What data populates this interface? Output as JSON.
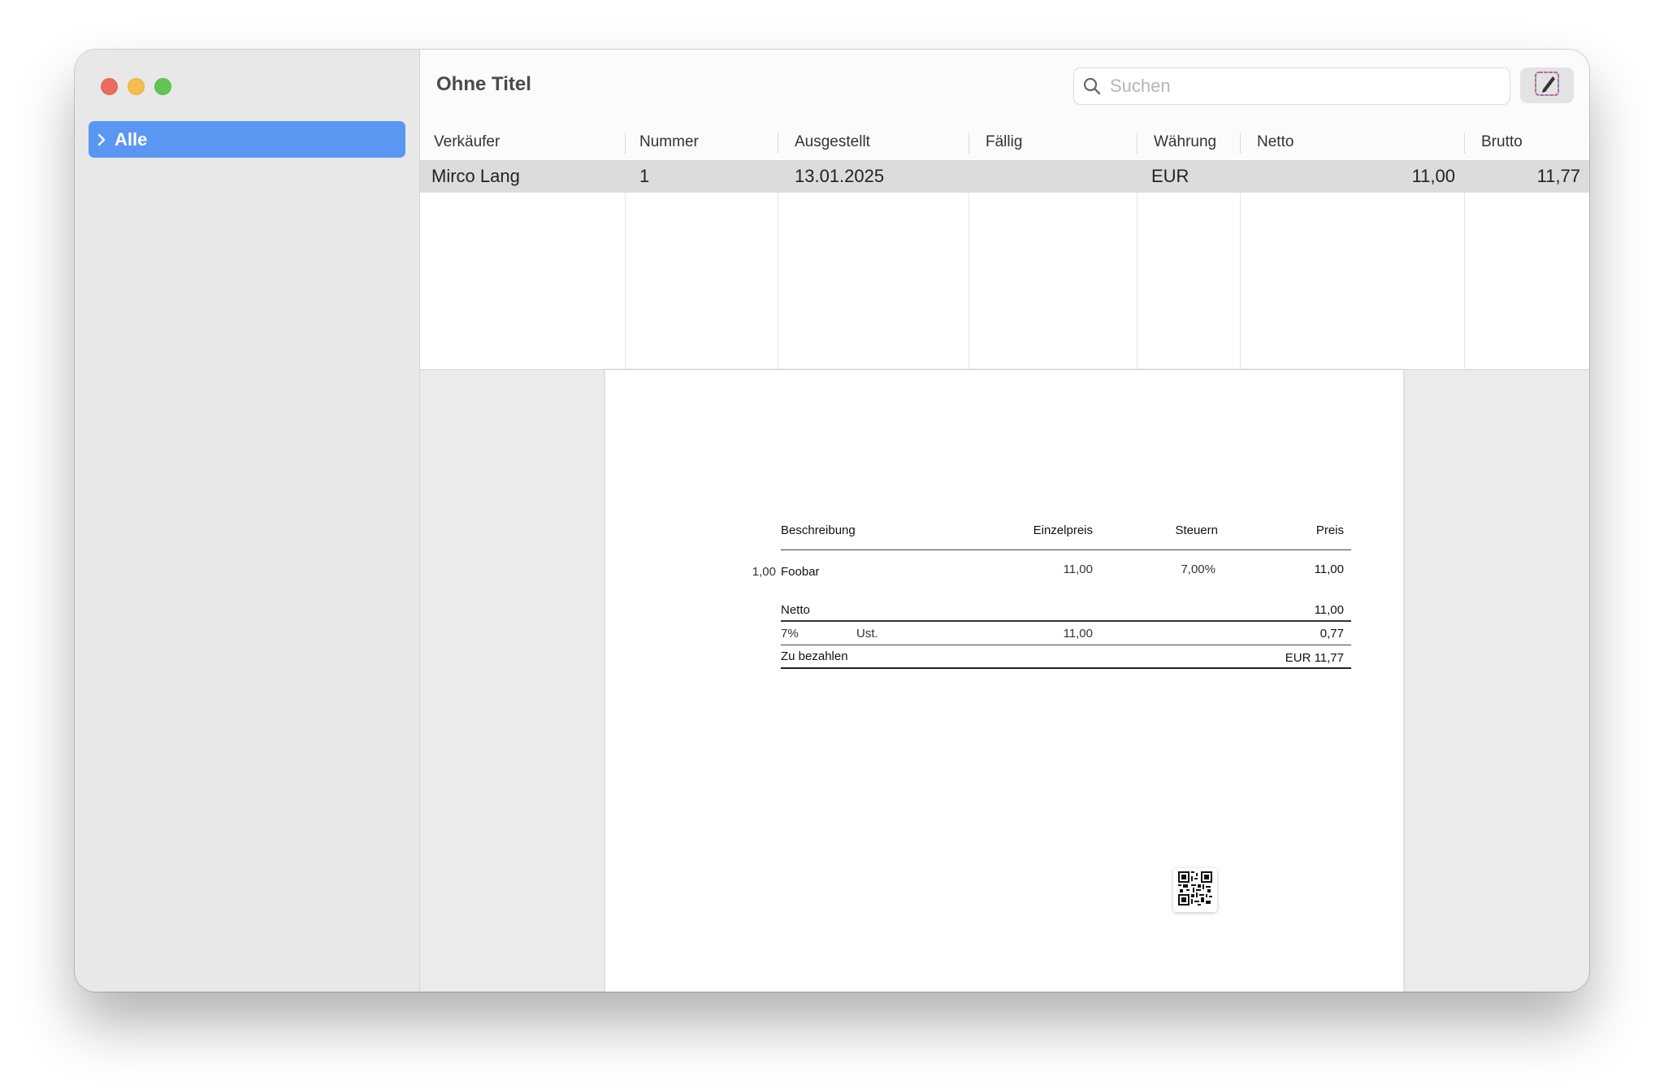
{
  "window": {
    "title": "Ohne Titel"
  },
  "sidebar": {
    "items": [
      {
        "label": "Alle"
      }
    ]
  },
  "search": {
    "placeholder": "Suchen"
  },
  "table": {
    "columns": [
      "Verkäufer",
      "Nummer",
      "Ausgestellt",
      "Fällig",
      "Währung",
      "Netto",
      "Brutto"
    ],
    "rows": [
      {
        "verkaeufer": "Mirco Lang",
        "nummer": "1",
        "ausgestellt": "13.01.2025",
        "faellig": "",
        "waehrung": "EUR",
        "netto": "11,00",
        "brutto": "11,77"
      }
    ]
  },
  "invoice": {
    "headers": {
      "description": "Beschreibung",
      "unit_price": "Einzelpreis",
      "tax": "Steuern",
      "price": "Preis"
    },
    "items": [
      {
        "qty": "1,00",
        "description": "Foobar",
        "unit_price": "11,00",
        "tax": "7,00%",
        "price": "11,00"
      }
    ],
    "net_label": "Netto",
    "net_value": "11,00",
    "vat": {
      "rate": "7%",
      "label": "Ust.",
      "base": "11,00",
      "amount": "0,77"
    },
    "total_label": "Zu bezahlen",
    "total_value": "EUR 11,77"
  },
  "colors": {
    "accent": "#5a97f2",
    "selected_row": "#dcdcdc"
  }
}
